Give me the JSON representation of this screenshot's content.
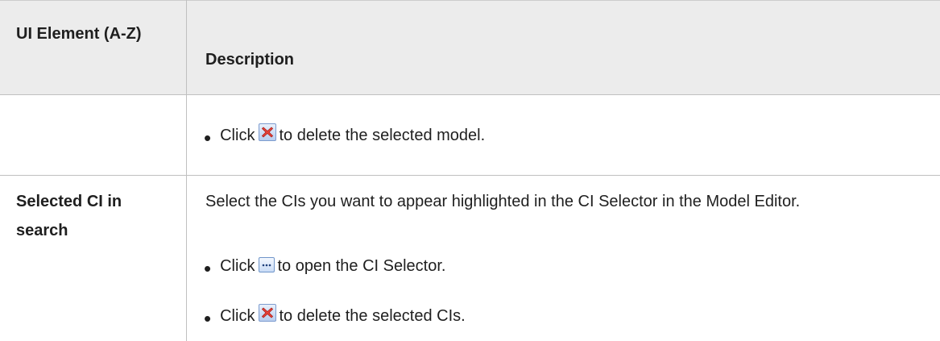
{
  "table": {
    "headers": {
      "element": "UI Element (A-Z)",
      "description": "Description"
    },
    "rows": [
      {
        "name": "",
        "bullets": [
          {
            "prefix": "Click",
            "icon": "delete-icon",
            "suffix": "to delete the selected model."
          }
        ]
      },
      {
        "name": "Selected CI in search",
        "description": "Select the CIs you want to appear highlighted in the CI Selector in the Model Editor.",
        "bullets": [
          {
            "prefix": "Click",
            "icon": "ellipsis-browse-icon",
            "suffix": "to open the CI Selector."
          },
          {
            "prefix": "Click",
            "icon": "delete-icon",
            "suffix": "to delete the selected CIs."
          }
        ]
      }
    ]
  },
  "colors": {
    "header_background": "#ececec",
    "grid_line": "#c0c0c0",
    "delete_icon_red": "#e8433a"
  }
}
